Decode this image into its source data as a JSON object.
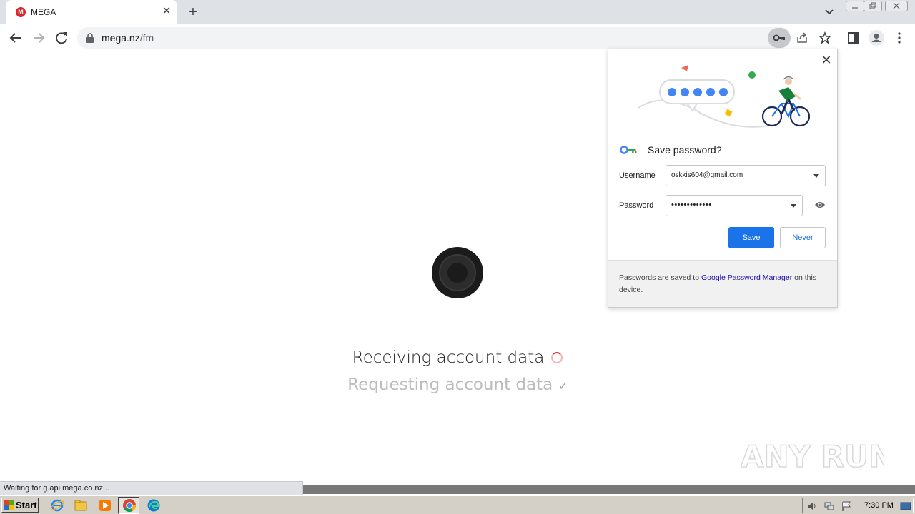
{
  "browser": {
    "tab": {
      "favicon_letter": "M",
      "title": "MEGA"
    },
    "new_tab_symbol": "+",
    "close_symbol": "✕",
    "url_host": "mega.nz",
    "url_path": "/fm"
  },
  "page": {
    "status_main": "Receiving account data",
    "status_sub": "Requesting account data",
    "check_symbol": "✓"
  },
  "password_bubble": {
    "close_symbol": "✕",
    "heading": "Save password?",
    "username_label": "Username",
    "username_value": "oskkis604@gmail.com",
    "password_label": "Password",
    "password_value": "•••••••••••••",
    "save_label": "Save",
    "never_label": "Never",
    "footer_before": "Passwords are saved to ",
    "footer_link": "Google Password Manager",
    "footer_after": " on this device."
  },
  "status_bubble": "Waiting for g.api.mega.co.nz...",
  "watermark": "ANY RUN",
  "taskbar": {
    "start_label": "Start",
    "clock": "7:30 PM"
  },
  "colors": {
    "accent_blue": "#1a73e8",
    "mega_red": "#d9272e",
    "spinner_red": "#e0333a"
  }
}
